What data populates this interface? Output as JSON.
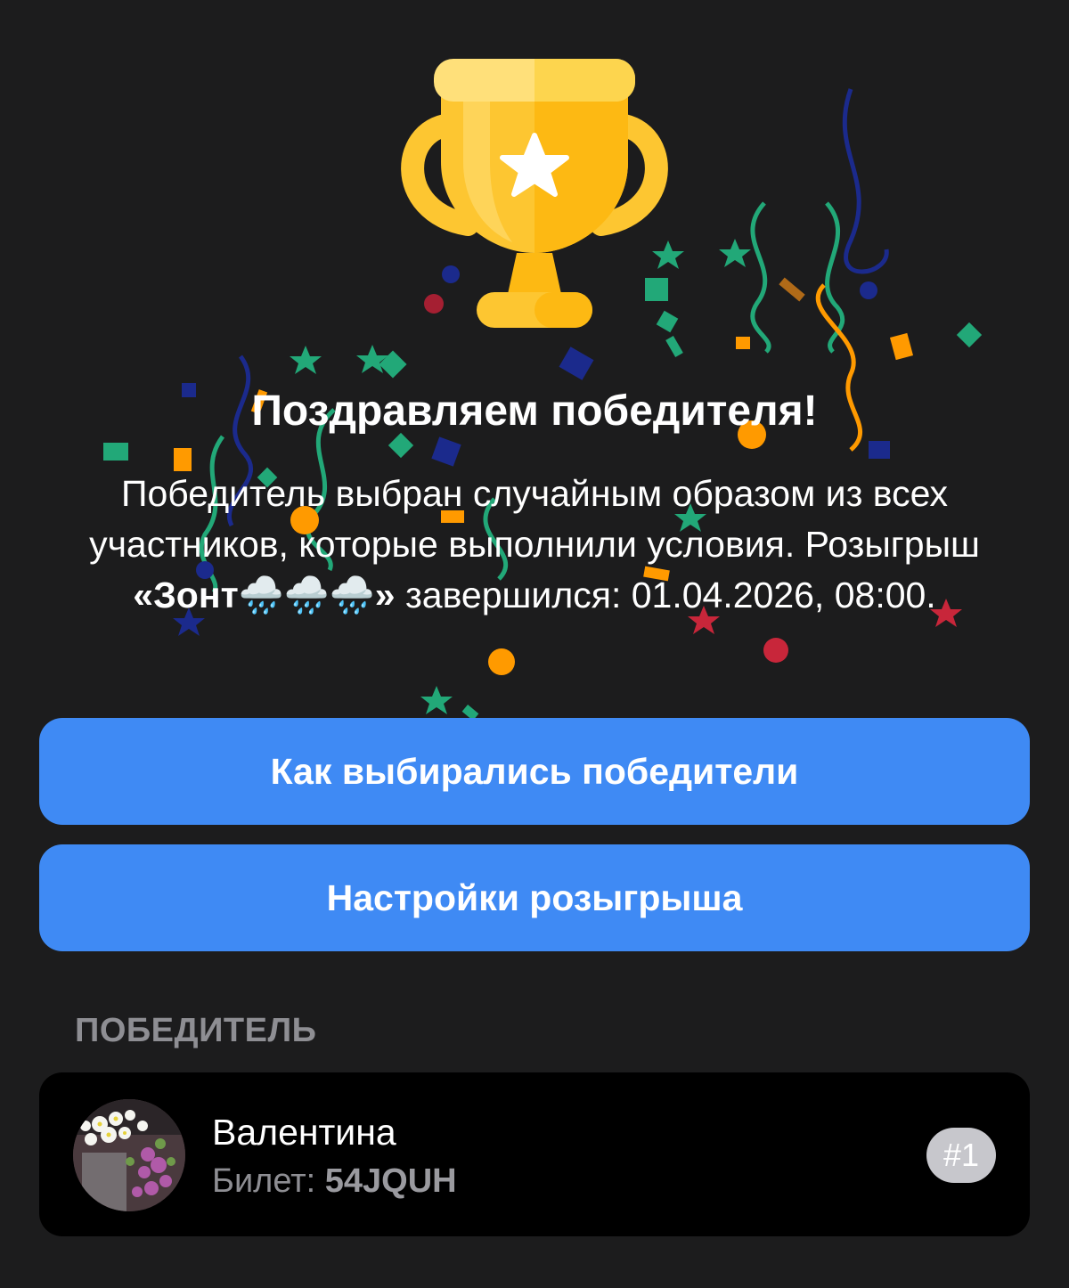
{
  "hero": {
    "icon": "trophy-star-icon",
    "title": "Поздравляем победителя!",
    "description_line1": "Победитель выбран случайным образом из всех участников, которые выполнили условия.",
    "description_prefix": "Розыгрыш ",
    "giveaway_name": "«Зонт🌧️🌧️🌧️»",
    "description_suffix": " завершился: 01.04.2026, 08:00."
  },
  "buttons": {
    "how_winners_chosen": "Как выбирались победители",
    "giveaway_settings": "Настройки розыгрыша"
  },
  "winner_section": {
    "header": "ПОБЕДИТЕЛЬ",
    "winners": [
      {
        "name": "Валентина",
        "ticket_label": "Билет:",
        "ticket_code": "54JQUH",
        "rank": "#1",
        "avatar": "flowers-photo"
      }
    ]
  },
  "colors": {
    "background": "#1c1c1d",
    "accent_button": "#3f8af4",
    "card_background": "#000000",
    "muted_text": "#8e8e93",
    "trophy_gold": "#fdc631",
    "confetti_green": "#22a878",
    "confetti_orange": "#ff9a00",
    "confetti_navy": "#1b2a8c",
    "confetti_red": "#c8263a"
  }
}
